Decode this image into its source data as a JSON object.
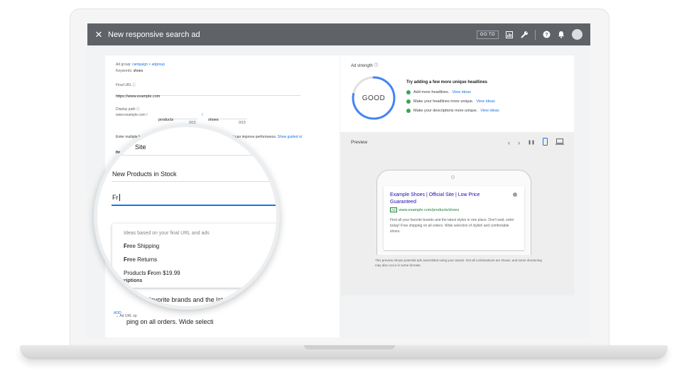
{
  "topbar": {
    "close_glyph": "✕",
    "title": "New responsive search ad",
    "goto_label": "GO TO",
    "icons": [
      "reports-icon",
      "tools-icon",
      "help-icon",
      "notifications-icon",
      "account-avatar"
    ]
  },
  "form": {
    "ad_group_label": "Ad group:",
    "ad_group_value": "campaign > adgroup",
    "keywords_label": "Keywords:",
    "keywords_value": "shoes",
    "final_url_label": "Final URL ⓘ",
    "final_url_value": "https://www.example.com",
    "display_path_label": "Display path ⓘ",
    "display_path_prefix": "www.example.com /",
    "path1_value": "products",
    "path_separator": "/",
    "path2_value": "shoes",
    "path1_count": "0/15",
    "path2_count": "0/15",
    "instructions": "Enter multiple headlines and descriptions. They'll be combined into ads that can improve performance.",
    "instructions_link": "Show guided st",
    "headlines_label": "Headlines",
    "headlines_prefix": "t",
    "ad_url_options": "Ad URL op",
    "add_label": "ADD"
  },
  "magnifier": {
    "headline_1": "Site",
    "headline_2": "New Products in Stock",
    "headline_3_input": "Fr",
    "suggestion_hint": "Ideas based on your final URL and ads",
    "suggestions": [
      {
        "bold": "Fr",
        "rest": "ee Shipping"
      },
      {
        "bold": "Fr",
        "rest": "ee Returns"
      },
      {
        "plain": "Products ",
        "bold": "Fr",
        "rest": "om $19.99"
      }
    ],
    "descriptions_label": "Descriptions",
    "description_1": "Find all your favorite brands and the latest styles i",
    "add_label": "ADD",
    "description_2": "ping on all orders. Wide selecti"
  },
  "ad_strength": {
    "label": "Ad strength ⓘ",
    "rating": "GOOD",
    "fraction": 0.78,
    "ring_color": "#4285f4",
    "tip_title": "Try adding a few more unique headlines",
    "tips": [
      {
        "text": "Add more headlines.",
        "link": "View ideas",
        "color": "#34a853"
      },
      {
        "text": "Make your headlines more unique.",
        "link": "View ideas",
        "color": "#34a853"
      },
      {
        "text": "Make your descriptions more unique.",
        "link": "View ideas",
        "color": "#34a853"
      }
    ]
  },
  "preview": {
    "label": "Preview",
    "controls": [
      "‹",
      "›",
      "❚❚"
    ],
    "ad_headline": "Example Shoes | Official Site | Low Price Guaranteed",
    "ad_badge": "Ad",
    "ad_url": "www.example.com/products/shoes",
    "ad_description": "Find all your favorite brands and the latest styles in one place. Don't wait, order today! Free shipping on all orders. Wide selection of stylish and comfortable shoes.",
    "note": "This preview shows potential ads assembled using your assets. Not all combinations are shown, and some shortening may also occur in some formats."
  }
}
